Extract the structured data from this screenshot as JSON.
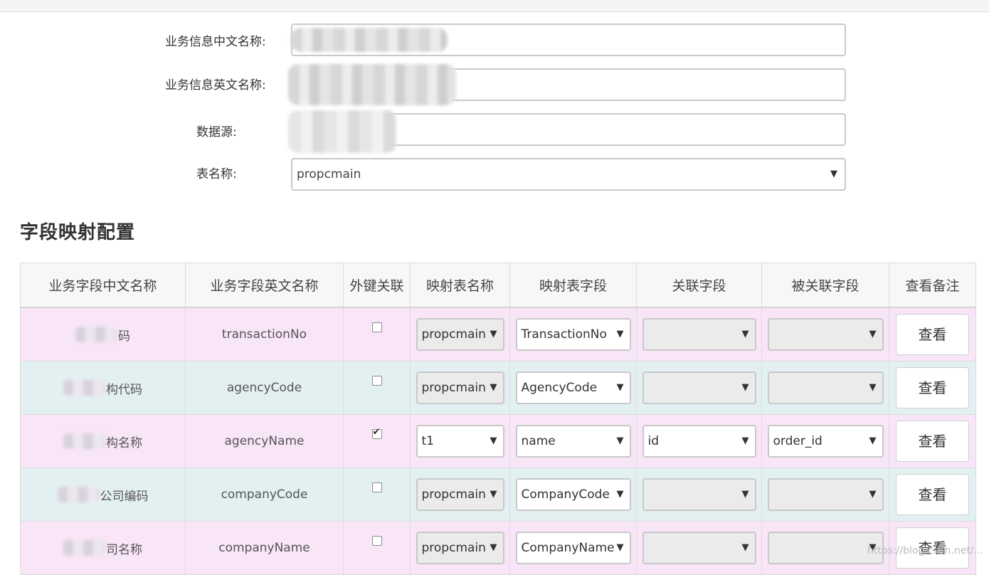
{
  "form": {
    "cn_name_label": "业务信息中文名称:",
    "en_name_label": "业务信息英文名称:",
    "datasource_label": "数据源:",
    "table_name_label": "表名称:",
    "table_name_value": "propcmain"
  },
  "section_title": "字段映射配置",
  "table": {
    "headers": [
      "业务字段中文名称",
      "业务字段英文名称",
      "外键关联",
      "映射表名称",
      "映射表字段",
      "关联字段",
      "被关联字段",
      "查看备注"
    ],
    "rows": [
      {
        "cn": "码",
        "en": "transactionNo",
        "fk": false,
        "map_table": "propcmain",
        "map_field": "TransactionNo",
        "link_field": "",
        "linked_field": "",
        "view": "查看"
      },
      {
        "cn": "构代码",
        "en": "agencyCode",
        "fk": false,
        "map_table": "propcmain",
        "map_field": "AgencyCode",
        "link_field": "",
        "linked_field": "",
        "view": "查看"
      },
      {
        "cn": "构名称",
        "en": "agencyName",
        "fk": true,
        "map_table": "t1",
        "map_field": "name",
        "link_field": "id",
        "linked_field": "order_id",
        "view": "查看"
      },
      {
        "cn": "公司编码",
        "en": "companyCode",
        "fk": false,
        "map_table": "propcmain",
        "map_field": "CompanyCode",
        "link_field": "",
        "linked_field": "",
        "view": "查看"
      },
      {
        "cn": "司名称",
        "en": "companyName",
        "fk": false,
        "map_table": "propcmain",
        "map_field": "CompanyName",
        "link_field": "",
        "linked_field": "",
        "view": "查看"
      }
    ]
  },
  "dropdown_caret": "▼",
  "watermark": "https://blog.csdn.net/..."
}
